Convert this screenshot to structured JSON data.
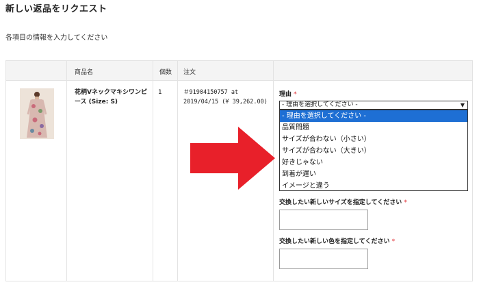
{
  "page": {
    "title": "新しい返品をリクエスト",
    "instructions": "各項目の情報を入力してください"
  },
  "table": {
    "headers": {
      "product": "商品名",
      "quantity": "個数",
      "order": "注文"
    },
    "row": {
      "product_name": "花柄Vネックマキシワンピース (Size: S)",
      "quantity": "1",
      "order_number": "＃91904150757 at",
      "order_date_price": "2019/04/15 (¥ 39,262.00)"
    }
  },
  "form": {
    "reason_label": "理由",
    "required_mark": "*",
    "reason_selected": "- 理由を選択してください -",
    "reason_options": [
      "- 理由を選択してください -",
      "品質問題",
      "サイズが合わない（小さい）",
      "サイズが合わない（大きい）",
      "好きじゃない",
      "到着が遅い",
      "イメージと違う"
    ],
    "size_label": "交換したい新しいサイズを指定してください",
    "color_label": "交換したい新しい色を指定してください"
  },
  "colors": {
    "highlight": "#1e6fd4",
    "arrow": "#e8202a",
    "required": "#e0282e"
  }
}
